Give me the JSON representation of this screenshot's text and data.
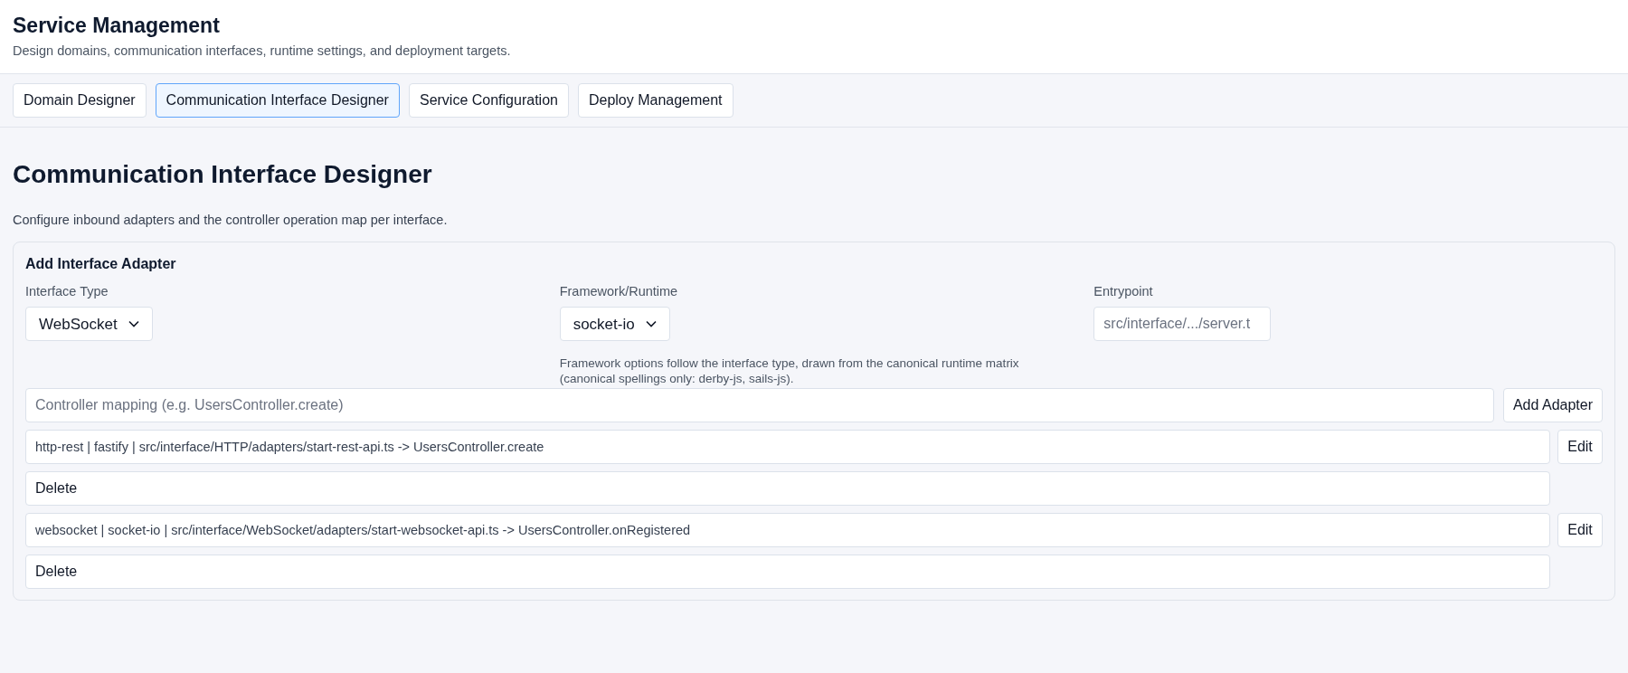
{
  "header": {
    "title": "Service Management",
    "subtitle": "Design domains, communication interfaces, runtime settings, and deployment targets."
  },
  "tabs": [
    {
      "label": "Domain Designer",
      "selected": false
    },
    {
      "label": "Communication Interface Designer",
      "selected": true
    },
    {
      "label": "Service Configuration",
      "selected": false
    },
    {
      "label": "Deploy Management",
      "selected": false
    }
  ],
  "section": {
    "title": "Communication Interface Designer",
    "description": "Configure inbound adapters and the controller operation map per interface."
  },
  "card": {
    "title": "Add Interface Adapter",
    "fields": [
      {
        "kind": "select",
        "label": "Interface Type",
        "value": "WebSocket"
      },
      {
        "kind": "select",
        "label": "Framework/Runtime",
        "value": "socket-io",
        "help": "Framework options follow the interface type, drawn from the canonical runtime matrix (canonical spellings only: derby-js, sails-js)."
      },
      {
        "kind": "input",
        "label": "Entrypoint",
        "placeholder": "src/interface/.../server.t"
      }
    ],
    "mapping": {
      "placeholder": "Controller mapping (e.g. UsersController.create)"
    },
    "add_button": "Add Adapter",
    "adapters": [
      {
        "value": "http-rest | fastify | src/interface/HTTP/adapters/start-rest-api.ts -> UsersController.create",
        "edit": "Edit",
        "delete": "Delete"
      },
      {
        "value": "websocket | socket-io | src/interface/WebSocket/adapters/start-websocket-api.ts -> UsersController.onRegistered",
        "edit": "Edit",
        "delete": "Delete"
      }
    ]
  }
}
